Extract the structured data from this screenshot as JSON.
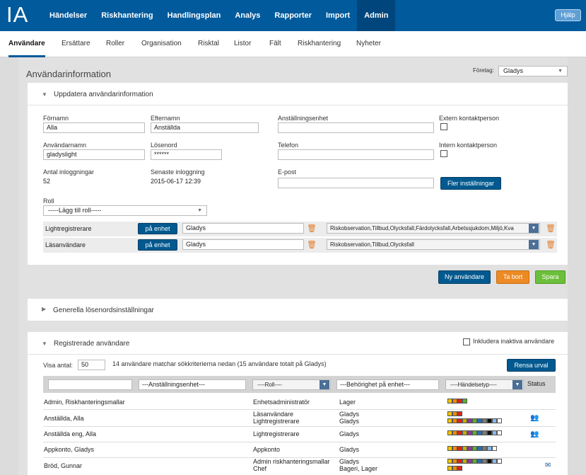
{
  "app": {
    "logo": "IA",
    "help_label": "Hjälp"
  },
  "main_nav": [
    "Händelser",
    "Riskhantering",
    "Handlingsplan",
    "Analys",
    "Rapporter",
    "Import",
    "Admin"
  ],
  "sub_nav": [
    "Användare",
    "Ersättare",
    "Roller",
    "Organisation",
    "Risktal",
    "Listor",
    "Fält",
    "Riskhantering",
    "Nyheter"
  ],
  "page": {
    "title": "Användarinformation",
    "company_label": "Företag:",
    "company_value": "Gladys"
  },
  "update_panel": {
    "title": "Uppdatera användarinformation",
    "first_name_label": "Förnamn",
    "first_name": "Alla",
    "last_name_label": "Efternamn",
    "last_name": "Anställda",
    "unit_label": "Anställningsenhet",
    "unit": "",
    "external_label": "Extern kontaktperson",
    "username_label": "Användarnamn",
    "username": "gladyslight",
    "password_label": "Lösenord",
    "password": "******",
    "phone_label": "Telefon",
    "phone": "",
    "internal_label": "Intern kontaktperson",
    "logins_label": "Antal inloggningar",
    "logins": "52",
    "last_login_label": "Senaste inloggning",
    "last_login": "2015-06-17 12:39",
    "email_label": "E-post",
    "email": "",
    "more_settings": "Fler inställningar",
    "role_label": "Roll",
    "role_select": "-----Lägg till roll-----",
    "roles": [
      {
        "name": "Lightregistrerare",
        "button": "på enhet",
        "unit": "Gladys",
        "events": "Riskobservation,Tillbud,Olycksfall,Färdolycksfall,Arbetssjukdom,Miljö,Kva"
      },
      {
        "name": "Läsanvändare",
        "button": "på enhet",
        "unit": "Gladys",
        "events": "Riskobservation,Tillbud,Olycksfall"
      }
    ]
  },
  "actions": {
    "new_user": "Ny användare",
    "delete": "Ta bort",
    "save": "Spara"
  },
  "password_panel": {
    "title": "Generella lösenordsinställningar"
  },
  "users_panel": {
    "title": "Registrerade användare",
    "include_inactive": "Inkludera inaktiva användare",
    "show_count_label": "Visa antal:",
    "show_count": "50",
    "summary": "14 användare matchar sökkriterierna nedan (15 användare totalt på Gladys)",
    "reset": "Rensa urval",
    "filters": {
      "name": "",
      "unit": "---Anställningsenhet---",
      "role": "----Roll----",
      "permission": "---Behörighet på enhet---",
      "event_type": "----Händelsetyp----",
      "status": "Status"
    },
    "rows": [
      {
        "name": "Admin, Riskhanteringsmallar",
        "role": "Enhetsadministratör",
        "role2": "",
        "unit": "Lager",
        "unit2": ""
      },
      {
        "name": "Anställda, Alla",
        "role": "Läsanvändare",
        "role2": "Lightregistrerare",
        "unit": "Gladys",
        "unit2": "Gladys"
      },
      {
        "name": "Anställda eng, Alla",
        "role": "Lightregistrerare",
        "role2": "",
        "unit": "Gladys",
        "unit2": ""
      },
      {
        "name": "Appkonto, Gladys",
        "role": "Appkonto",
        "role2": "",
        "unit": "Gladys",
        "unit2": ""
      },
      {
        "name": "Bröd, Gunnar",
        "role": "Admin riskhanteringsmallar",
        "role2": "Chef",
        "unit": "Gladys",
        "unit2": "Bageri, Lager"
      }
    ]
  },
  "colors": {
    "primary": "#005a9c",
    "orange": "#ec8a24",
    "green": "#6cbf3a"
  }
}
